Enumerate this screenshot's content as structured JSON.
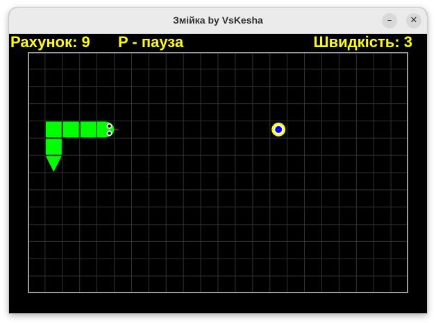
{
  "window": {
    "title": "Змійка by VsKesha",
    "minimize_glyph": "–",
    "close_glyph": "✕"
  },
  "hud": {
    "score_text": "Рахунок: 9",
    "pause_hint": "P - пауза",
    "speed_text": "Швидкість: 3"
  },
  "board": {
    "cols": 22,
    "rows": 14,
    "grid_color": "#333333",
    "border_color": "#9a9a9a",
    "snake_color": "#00ff00",
    "snake_direction": "right",
    "snake_cells": [
      [
        4,
        4
      ],
      [
        3,
        4
      ],
      [
        2,
        4
      ],
      [
        1,
        4
      ],
      [
        1,
        5
      ],
      [
        1,
        6
      ]
    ],
    "food_cell": [
      14,
      4
    ],
    "food_colors": {
      "ring": "#ffff00",
      "center": "#0000ff"
    }
  }
}
